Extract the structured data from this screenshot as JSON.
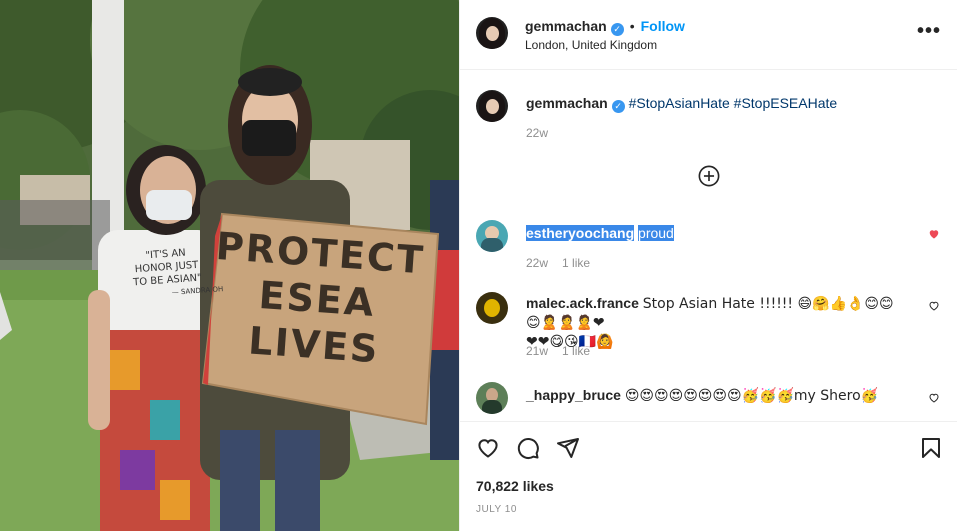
{
  "header": {
    "username": "gemmachan",
    "follow_label": "Follow",
    "separator": "•",
    "location": "London, United Kingdom",
    "more_label": "•••"
  },
  "caption": {
    "username": "gemmachan",
    "hashtags": "#StopAsianHate #StopESEAHate",
    "age": "22w"
  },
  "comments": [
    {
      "username": "estheryoochang",
      "text": "proud",
      "age": "22w",
      "likes": "1 like",
      "liked": true
    },
    {
      "username": "malec.ack.france",
      "text": "Stop Asian Hate !!!!!! 😄🤗👍👌😊😊😊🙎🙎🙎❤",
      "text2": "❤❤😋😘🇫🇷🙆",
      "age": "21w",
      "likes": "1 like",
      "liked": false
    },
    {
      "username": "_happy_bruce",
      "text": "😍😍😍😍😍😍😍😍🥳🥳🥳my Shero🥳",
      "liked": false
    }
  ],
  "sign": {
    "line1": "PROTECT",
    "line2": "ESEA",
    "line3": "LIVES"
  },
  "shirt_text": {
    "line1": "\"IT'S AN",
    "line2": "HONOR JUST",
    "line3": "TO BE ASIAN\"",
    "line4": "— SANDRA OH"
  },
  "footer": {
    "likes": "70,822 likes",
    "date": "JULY 10"
  },
  "colors": {
    "link": "#0095f6",
    "hashtag": "#00376b",
    "liked_heart": "#ed4956",
    "muted": "#8e8e8e"
  }
}
